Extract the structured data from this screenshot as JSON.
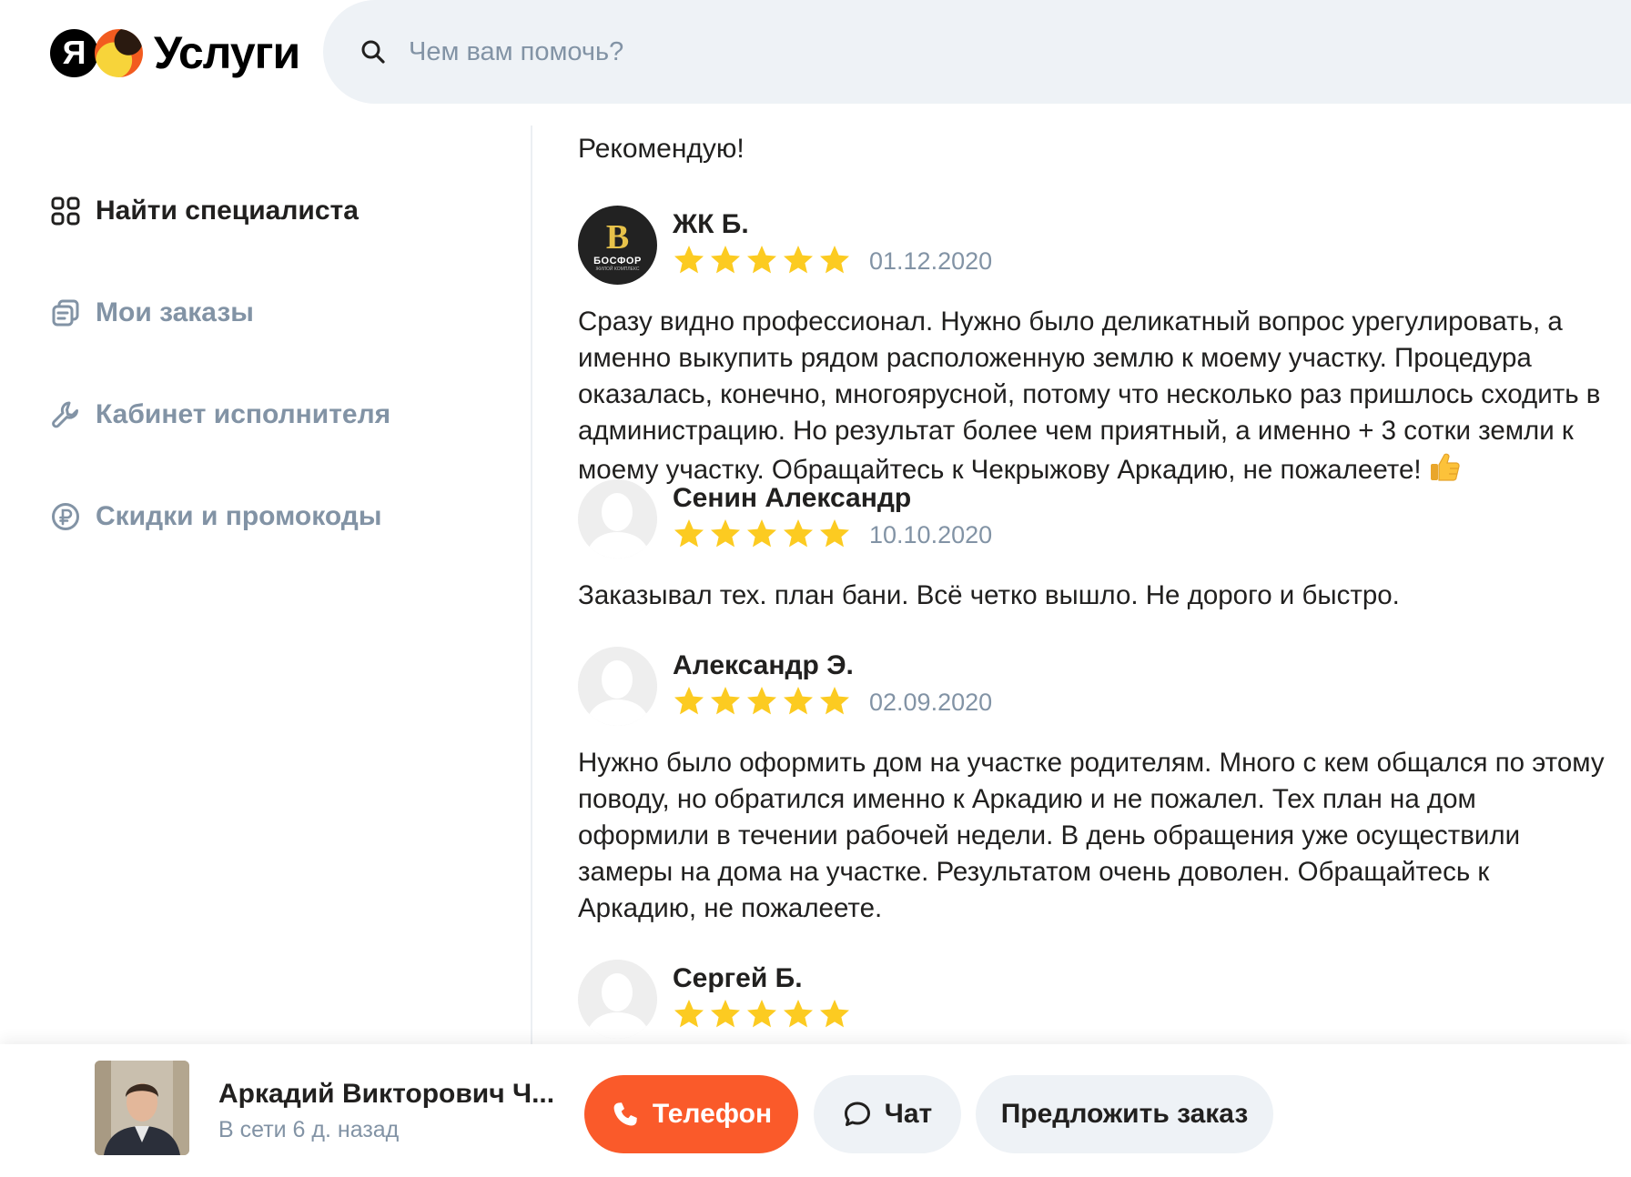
{
  "brand": {
    "ya": "Я",
    "name": "Услуги"
  },
  "search": {
    "placeholder": "Чем вам помочь?"
  },
  "sidebar": {
    "items": [
      {
        "label": "Найти специалиста",
        "icon": "grid-icon"
      },
      {
        "label": "Мои заказы",
        "icon": "orders-icon"
      },
      {
        "label": "Кабинет исполнителя",
        "icon": "wrench-icon"
      },
      {
        "label": "Скидки и промокоды",
        "icon": "ruble-icon"
      }
    ]
  },
  "reviews": {
    "previous_tail": "Рекомендую!",
    "items": [
      {
        "author": "ЖК Б.",
        "rating": 5,
        "date": "01.12.2020",
        "avatar": {
          "type": "company",
          "letter": "B",
          "brand": "БОСФОР",
          "sub": "ЖИЛОЙ КОМПЛЕКС"
        },
        "text": "Сразу видно профессионал. Нужно было деликатный вопрос урегулировать, а именно выкупить рядом расположенную землю к моему участку. Процедура оказалась, конечно, многоярусной, потому что несколько раз пришлось сходить в администрацию. Но результат более чем приятный, а именно + 3 сотки земли к моему участку. Обращайтесь к Чекрыжову Аркадию, не пожалеете!"
      },
      {
        "author": "Сенин Александр",
        "rating": 5,
        "date": "10.10.2020",
        "avatar": {
          "type": "placeholder"
        },
        "text": "Заказывал тех. план бани. Всё четко вышло. Не дорого и быстро."
      },
      {
        "author": "Александр Э.",
        "rating": 5,
        "date": "02.09.2020",
        "avatar": {
          "type": "placeholder"
        },
        "text": "Нужно было оформить дом на участке родителям. Много с кем общался по этому поводу, но обратился именно к Аркадию и не пожалел. Тех план на дом оформили в течении рабочей недели. В день обращения уже осуществили замеры на дома на участке. Результатом очень доволен. Обращайтесь к Аркадию, не пожалеете."
      },
      {
        "author": "Сергей Б.",
        "rating": 5,
        "avatar": {
          "type": "placeholder"
        }
      }
    ]
  },
  "bottom_bar": {
    "name": "Аркадий Викторович Ч...",
    "status": "В сети 6 д. назад",
    "phone_label": "Телефон",
    "chat_label": "Чат",
    "offer_label": "Предложить заказ"
  },
  "colors": {
    "accent": "#fa5a2a",
    "star": "#fccb21",
    "muted": "#8293a5",
    "search_bg": "#eef2f6",
    "text": "#21201f"
  }
}
